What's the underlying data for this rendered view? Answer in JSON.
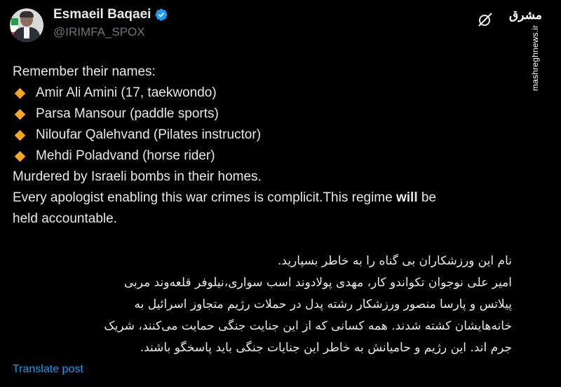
{
  "author": {
    "display_name": "Esmaeil Baqaei",
    "handle": "@IRIMFA_SPOX"
  },
  "watermark": {
    "logo_text": "مشرق",
    "url": "mashreghnews.ir"
  },
  "tweet": {
    "intro": "Remember their names:",
    "bullets": [
      "Amir Ali Amini (17, taekwondo)",
      "Parsa Mansour (paddle sports)",
      "Niloufar Qalehvand (Pilates instructor)",
      "Mehdi Poladvand (horse rider)"
    ],
    "line_murdered": "Murdered by Israeli bombs in their homes.",
    "line_apologist_part1": "Every apologist enabling this war crimes is complicit.This regime ",
    "line_apologist_bold": "will",
    "line_apologist_part2": " be",
    "line_accountable": "held accountable.",
    "persian_lines": [
      "نام این ورزشکاران بی گناه را به خاطر بسپارید.",
      "امیر علی نوجوان تکواندو کار، مهدی پولادوند اسب سواری،نیلوفر قلعه‌وند مربی",
      "پیلاتس و پارسا منصور ورزشکار رشته پدل در حملات رژیم متجاوز اسرائیل به",
      "خانه‌هایشان کشته شدند. همه کسانی که از  این جنایت جنگی حمایت می‌کنند، شریک",
      "جرم اند. این رژیم و حامیانش به خاطر این جنایات جنگی باید پاسخگو باشند."
    ],
    "translate_label": "Translate post"
  },
  "colors": {
    "background": "#000000",
    "text": "#e7e9ea",
    "secondary": "#71767b",
    "link": "#1d9bf0",
    "bullet": "#f5a623",
    "verified": "#1d9bf0"
  },
  "icons": {
    "verified": "verified-badge-icon",
    "grok": "grok-icon",
    "bullet": "orange-diamond-icon"
  }
}
